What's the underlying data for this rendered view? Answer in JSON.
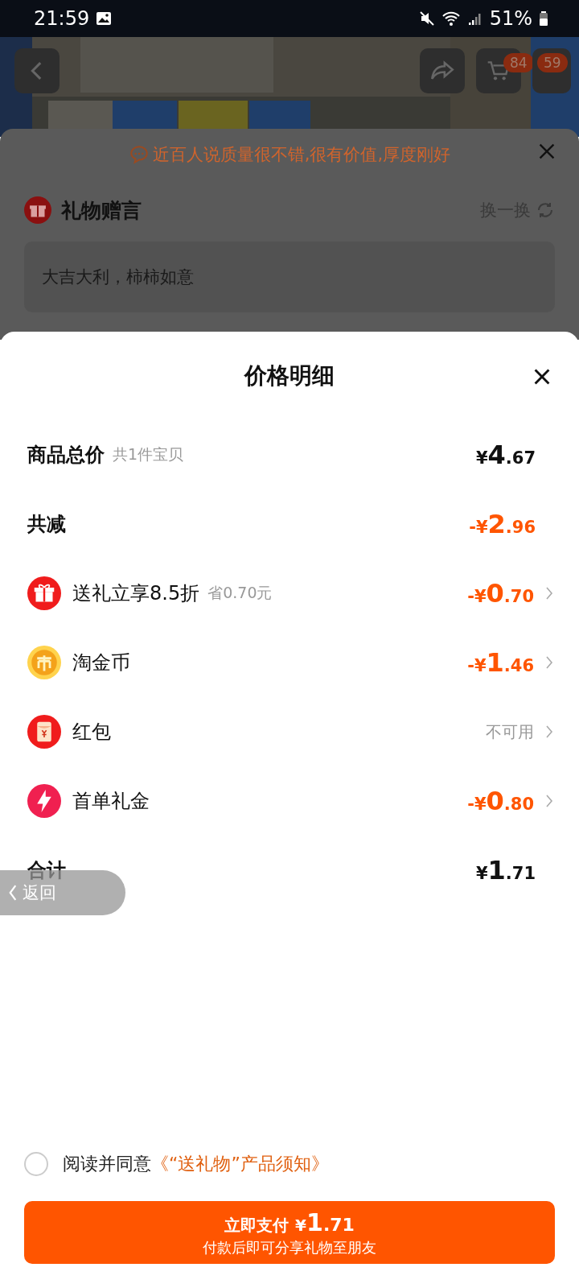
{
  "status_bar": {
    "time": "21:59",
    "battery": "51%"
  },
  "top_nav": {
    "cart_badge": "84",
    "more_badge": "59"
  },
  "gift_sheet": {
    "banner": "近百人说质量很不错,很有价值,厚度刚好",
    "title": "礼物赠言",
    "refresh": "换一换",
    "message": "大吉大利，柿柿如意"
  },
  "price_sheet": {
    "title": "价格明细",
    "rows": [
      {
        "kind": "header",
        "label": "商品总价",
        "hint": "共1件宝贝",
        "prefix": "¥",
        "integer": "4",
        "fraction": ".67",
        "highlight": false
      },
      {
        "kind": "header",
        "label": "共减",
        "prefix": "-¥",
        "integer": "2",
        "fraction": ".96",
        "highlight": true
      },
      {
        "kind": "item",
        "label": "送礼立享8.5折",
        "hint": "省0.70元",
        "prefix": "-¥",
        "integer": "0",
        "fraction": ".70",
        "highlight": true
      },
      {
        "kind": "item",
        "label": "淘金币",
        "prefix": "-¥",
        "integer": "1",
        "fraction": ".46",
        "highlight": true
      },
      {
        "kind": "item",
        "label": "红包",
        "status": "不可用"
      },
      {
        "kind": "item",
        "label": "首单礼金",
        "prefix": "-¥",
        "integer": "0",
        "fraction": ".80",
        "highlight": true
      },
      {
        "kind": "header",
        "label": "合计",
        "prefix": "¥",
        "integer": "1",
        "fraction": ".71",
        "highlight": false
      }
    ],
    "agreement": {
      "checked": false,
      "text": "阅读并同意",
      "link": "《“送礼物”产品须知》"
    },
    "pay_button": {
      "label": "立即支付",
      "prefix": "¥",
      "integer": "1",
      "fraction": ".71",
      "subtitle": "付款后即可分享礼物至朋友"
    }
  },
  "back_button": {
    "label": "返回"
  }
}
